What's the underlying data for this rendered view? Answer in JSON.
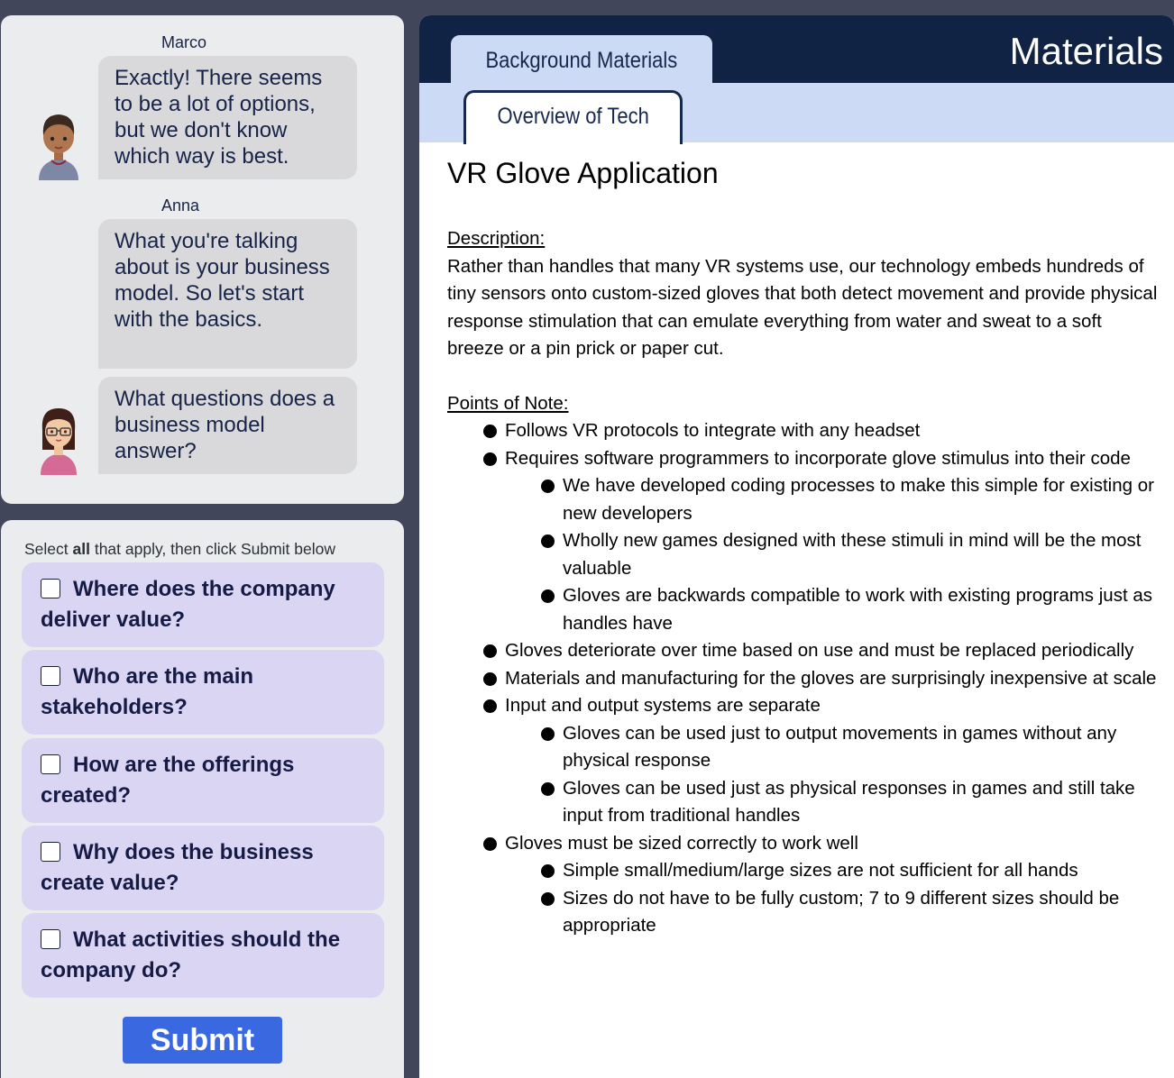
{
  "chat": {
    "messages": [
      {
        "sender": "Marco",
        "text": "Exactly! There seems to be a lot of options, but we don't know which way is best.",
        "avatar": "male-avatar"
      },
      {
        "sender": "Anna",
        "text": "What you're talking about is your business model. So let's start with the basics.",
        "avatar": "female-avatar"
      },
      {
        "sender": "",
        "text": "What questions does a business model answer?",
        "avatar": "female-avatar"
      }
    ]
  },
  "quiz": {
    "instructions_pre": "Select ",
    "instructions_bold": "all",
    "instructions_post": " that apply, then click Submit below",
    "options": [
      {
        "label": "Where does the company deliver value?",
        "checked": false
      },
      {
        "label": "Who are the main stakeholders?",
        "checked": false
      },
      {
        "label": "How are the offerings created?",
        "checked": false
      },
      {
        "label": "Why does the business create value?",
        "checked": false
      },
      {
        "label": "What activities should the company do?",
        "checked": false
      }
    ],
    "submit_label": "Submit"
  },
  "materials": {
    "header_title": "Materials",
    "tab_main": "Background Materials",
    "tab_sub": "Overview of Tech",
    "doc_title": "VR Glove Application",
    "description_label": "Description: ",
    "description": "Rather than handles that many VR systems use, our technology embeds hundreds of tiny sensors onto custom-sized gloves that both detect movement and provide physical response stimulation that can emulate everything from water and sweat to a soft breeze or a pin prick or paper cut.",
    "points_label": "Points of Note:",
    "points": [
      {
        "level": 1,
        "text": "Follows VR protocols to integrate with any headset"
      },
      {
        "level": 1,
        "text": "Requires software programmers to incorporate glove stimulus into their code"
      },
      {
        "level": 2,
        "text": "We have developed coding processes to make this simple for existing or new developers"
      },
      {
        "level": 2,
        "text": "Wholly new games designed with these stimuli in mind will be the most valuable"
      },
      {
        "level": 2,
        "text": "Gloves are backwards compatible to work with existing programs just as handles have"
      },
      {
        "level": 1,
        "text": "Gloves deteriorate over time based on use and must be replaced periodically"
      },
      {
        "level": 1,
        "text": "Materials and manufacturing for the gloves are surprisingly inexpensive at scale"
      },
      {
        "level": 1,
        "text": "Input and output systems are separate"
      },
      {
        "level": 2,
        "text": "Gloves can be used just to output movements in games without any physical response"
      },
      {
        "level": 2,
        "text": "Gloves can be used just as physical responses in games and still take input from traditional handles"
      },
      {
        "level": 1,
        "text": "Gloves must be sized correctly to work well"
      },
      {
        "level": 2,
        "text": "Simple small/medium/large sizes are not sufficient for all hands"
      },
      {
        "level": 2,
        "text": "Sizes do not have to be fully custom; 7 to 9 different sizes should be appropriate"
      }
    ]
  }
}
